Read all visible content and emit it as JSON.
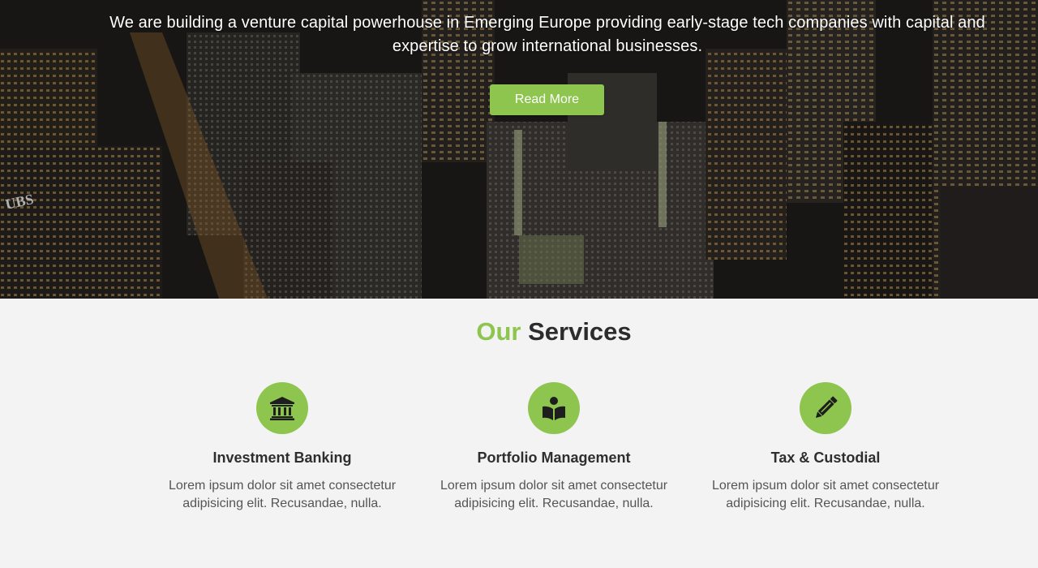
{
  "hero": {
    "tagline": "We are building a venture capital powerhouse in Emerging Europe providing early-stage tech companies with capital and expertise to grow international businesses.",
    "read_more_label": "Read More",
    "sign_text": "UBS"
  },
  "services": {
    "title_accent": "Our",
    "title_rest": "Services",
    "items": [
      {
        "icon": "bank-icon",
        "title": "Investment Banking",
        "description": "Lorem ipsum dolor sit amet consectetur adipisicing elit. Recusandae, nulla."
      },
      {
        "icon": "book-reader-icon",
        "title": "Portfolio Management",
        "description": "Lorem ipsum dolor sit amet consectetur adipisicing elit. Recusandae, nulla."
      },
      {
        "icon": "pencil-icon",
        "title": "Tax & Custodial",
        "description": "Lorem ipsum dolor sit amet consectetur adipisicing elit. Recusandae, nulla."
      }
    ]
  },
  "colors": {
    "accent": "#8dc54f",
    "background": "#f3f3f3",
    "heading": "#2c2c2c"
  }
}
